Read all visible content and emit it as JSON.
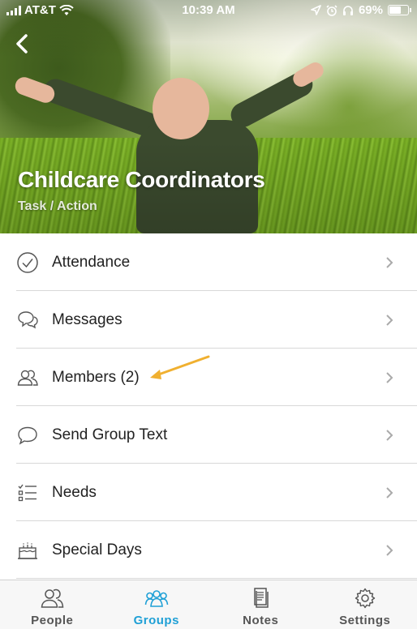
{
  "status_bar": {
    "carrier": "AT&T",
    "time": "10:39 AM",
    "battery": "69%",
    "battery_level": 0.69,
    "icons": [
      "signal-icon",
      "wifi-icon",
      "location-icon",
      "alarm-icon",
      "headphones-icon",
      "battery-icon"
    ]
  },
  "header": {
    "back_icon": "back-chevron-icon",
    "title": "Childcare Coordinators",
    "subtitle": "Task / Action"
  },
  "menu": {
    "items": [
      {
        "label": "Attendance",
        "icon": "check-circle-icon"
      },
      {
        "label": "Messages",
        "icon": "chat-bubbles-icon"
      },
      {
        "label": "Members (2)",
        "icon": "members-icon"
      },
      {
        "label": "Send Group Text",
        "icon": "speech-bubble-icon"
      },
      {
        "label": "Needs",
        "icon": "checklist-icon"
      },
      {
        "label": "Special Days",
        "icon": "cake-icon"
      }
    ]
  },
  "annotation": {
    "color": "#f0b030"
  },
  "tab_bar": {
    "tabs": [
      {
        "label": "People",
        "icon": "people-icon",
        "active": false
      },
      {
        "label": "Groups",
        "icon": "groups-icon",
        "active": true
      },
      {
        "label": "Notes",
        "icon": "notes-icon",
        "active": false
      },
      {
        "label": "Settings",
        "icon": "gear-icon",
        "active": false
      }
    ],
    "accent": "#1fa0d6"
  }
}
